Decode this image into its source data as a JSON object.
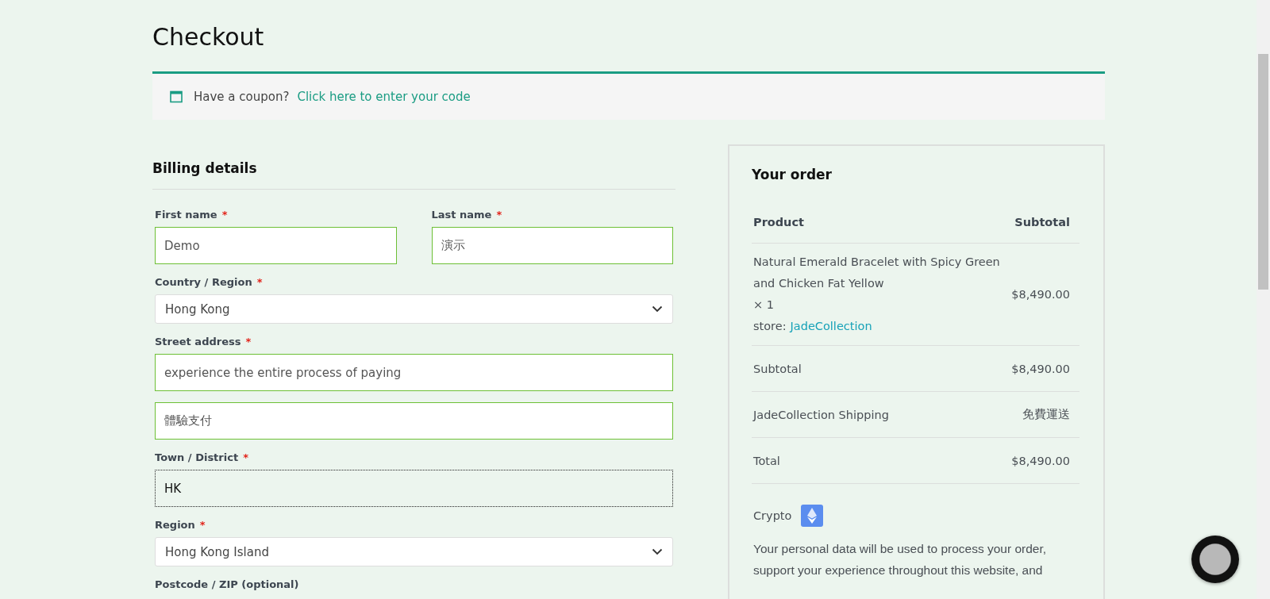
{
  "page_title": "Checkout",
  "coupon": {
    "text": "Have a coupon?",
    "link": "Click here to enter your code"
  },
  "billing": {
    "title": "Billing details",
    "rows": [
      [
        {
          "label": "First name",
          "required_mark": "*",
          "kind": "text",
          "inputs": [
            {
              "value": "Demo",
              "valid": true,
              "focused": false
            }
          ]
        },
        {
          "label": "Last name",
          "required_mark": "*",
          "kind": "text",
          "inputs": [
            {
              "value": "演示",
              "valid": true,
              "focused": false
            }
          ]
        }
      ],
      [
        {
          "label": "Country / Region",
          "required_mark": "*",
          "kind": "select",
          "inputs": [
            {
              "value": "Hong Kong"
            }
          ]
        }
      ],
      [
        {
          "label": "Street address",
          "required_mark": "*",
          "kind": "text",
          "inputs": [
            {
              "value": "experience the entire process of paying",
              "valid": true,
              "focused": false
            },
            {
              "value": "體驗支付",
              "valid": true,
              "focused": false
            }
          ]
        }
      ],
      [
        {
          "label": "Town / District",
          "required_mark": "*",
          "kind": "text",
          "inputs": [
            {
              "value": "HK",
              "focused": true
            }
          ]
        }
      ],
      [
        {
          "label": "Region",
          "required_mark": "*",
          "kind": "select",
          "inputs": [
            {
              "value": "Hong Kong Island"
            }
          ]
        }
      ],
      [
        {
          "label": "Postcode / ZIP (optional)"
        }
      ]
    ]
  },
  "order": {
    "title": "Your order",
    "columns": [
      "Product",
      "Subtotal"
    ],
    "item": {
      "name": "Natural Emerald Bracelet with Spicy Green and Chicken Fat Yellow",
      "quantity": "× 1",
      "store_label": "store:",
      "store": "JadeCollection",
      "price": "$8,490.00"
    },
    "totals": [
      {
        "label": "Subtotal",
        "value": "$8,490.00"
      },
      {
        "label": "JadeCollection Shipping",
        "value": "免費運送"
      },
      {
        "label": "Total",
        "value": "$8,490.00"
      }
    ],
    "payment": {
      "label": "Crypto"
    },
    "privacy": {
      "text": "Your personal data will be used to process your order, support your experience throughout this website, and"
    }
  }
}
